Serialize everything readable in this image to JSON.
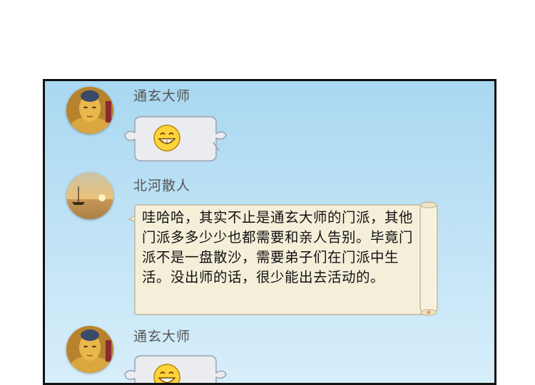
{
  "messages": [
    {
      "sender": "通玄大师",
      "avatar": "buddha-avatar",
      "type": "emoji",
      "emoji": "grinning-face"
    },
    {
      "sender": "北河散人",
      "avatar": "sunset-boat-avatar",
      "type": "text",
      "text": "哇哈哈，其实不止是通玄大师的门派，其他门派多多少少也都需要和亲人告别。毕竟门派不是一盘散沙，需要弟子们在门派中生活。没出师的话，很少能出去活动的。"
    },
    {
      "sender": "通玄大师",
      "avatar": "buddha-avatar",
      "type": "emoji",
      "emoji": "grinning-face"
    }
  ],
  "colors": {
    "panel_top": "#a9d7f1",
    "bubble": "#f5efda",
    "scroll": "#f8f1dd",
    "text": "#111111"
  }
}
